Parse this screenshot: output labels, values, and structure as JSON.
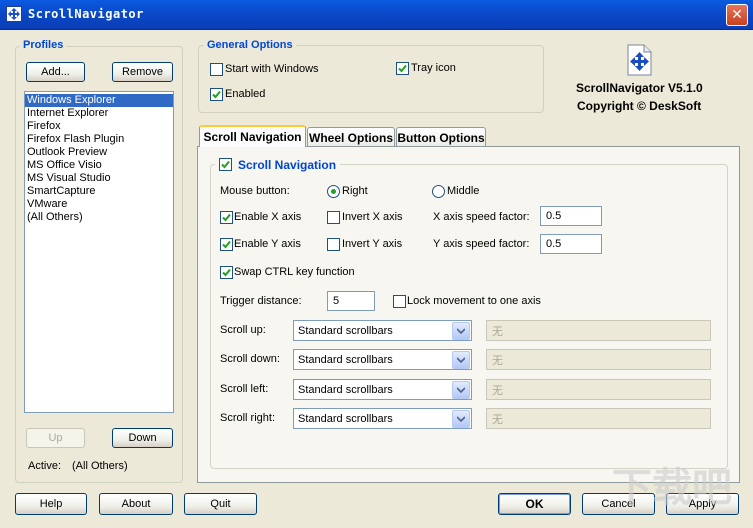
{
  "window": {
    "title": "ScrollNavigator"
  },
  "profiles": {
    "title": "Profiles",
    "add_label": "Add...",
    "remove_label": "Remove",
    "items": [
      "Windows Explorer",
      "Internet Explorer",
      "Firefox",
      "Firefox Flash Plugin",
      "Outlook Preview",
      "MS Office Visio",
      "MS Visual Studio",
      "SmartCapture",
      "VMware",
      "(All Others)"
    ],
    "selected_index": 0,
    "up_label": "Up",
    "down_label": "Down",
    "active_label": "Active:",
    "active_value": "(All Others)"
  },
  "general": {
    "title": "General Options",
    "start_with_windows": {
      "label": "Start with Windows",
      "checked": false
    },
    "tray_icon": {
      "label": "Tray icon",
      "checked": true
    },
    "enabled": {
      "label": "Enabled",
      "checked": true
    }
  },
  "about": {
    "version": "ScrollNavigator V5.1.0",
    "copyright": "Copyright © DeskSoft"
  },
  "tabs": [
    "Scroll Navigation",
    "Wheel Options",
    "Button Options"
  ],
  "active_tab": 0,
  "scroll": {
    "title": "Scroll Navigation",
    "enabled": true,
    "mouse_button_label": "Mouse button:",
    "right_label": "Right",
    "middle_label": "Middle",
    "selected_button": "Right",
    "enable_x": {
      "label": "Enable X axis",
      "checked": true
    },
    "invert_x": {
      "label": "Invert X axis",
      "checked": false
    },
    "x_speed_label": "X axis speed factor:",
    "x_speed_value": "0.5",
    "enable_y": {
      "label": "Enable Y axis",
      "checked": true
    },
    "invert_y": {
      "label": "Invert Y axis",
      "checked": false
    },
    "y_speed_label": "Y axis speed factor:",
    "y_speed_value": "0.5",
    "swap_ctrl": {
      "label": "Swap CTRL key function",
      "checked": true
    },
    "trigger_label": "Trigger distance:",
    "trigger_value": "5",
    "lock_movement": {
      "label": "Lock movement to one axis",
      "checked": false
    },
    "directions": [
      {
        "label": "Scroll up:",
        "value": "Standard scrollbars",
        "extra": "无"
      },
      {
        "label": "Scroll down:",
        "value": "Standard scrollbars",
        "extra": "无"
      },
      {
        "label": "Scroll left:",
        "value": "Standard scrollbars",
        "extra": "无"
      },
      {
        "label": "Scroll right:",
        "value": "Standard scrollbars",
        "extra": "无"
      }
    ]
  },
  "footer": {
    "help_label": "Help",
    "about_label": "About",
    "quit_label": "Quit",
    "ok_label": "OK",
    "cancel_label": "Cancel",
    "apply_label": "Apply"
  },
  "watermark": "下载吧"
}
